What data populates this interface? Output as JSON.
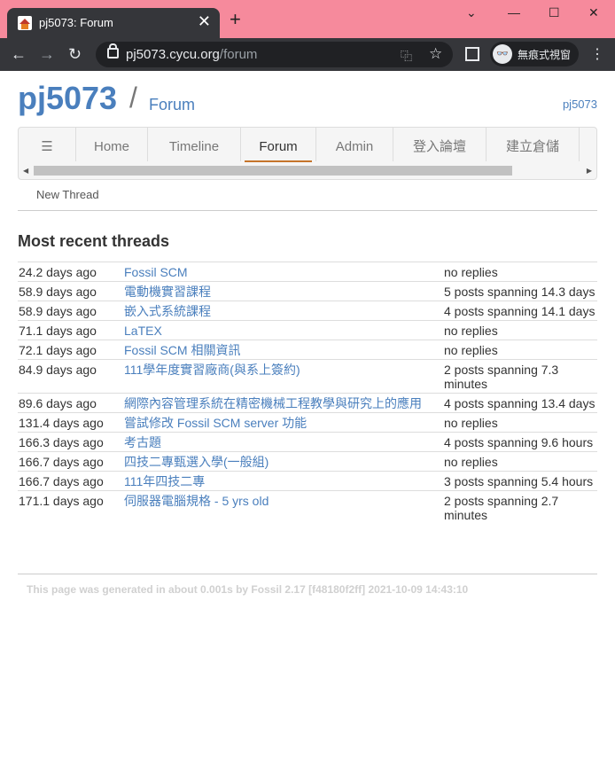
{
  "browser": {
    "tab_title": "pj5073: Forum",
    "tab_close": "✕",
    "new_tab": "+",
    "url_host": "pj5073.cycu.org",
    "url_path": "/forum",
    "incognito_label": "無痕式視窗"
  },
  "site": {
    "logo": "pj5073",
    "separator": "/",
    "section": "Forum",
    "user_link": "pj5073"
  },
  "menu": {
    "items": [
      "☰",
      "Home",
      "Timeline",
      "Forum",
      "Admin",
      "登入論壇",
      "建立倉儲"
    ],
    "active": "Forum"
  },
  "submenu": {
    "new_thread": "New Thread"
  },
  "threads": {
    "heading": "Most recent threads",
    "rows": [
      {
        "age": "24.2 days ago",
        "title": "Fossil SCM",
        "status": "no replies"
      },
      {
        "age": "58.9 days ago",
        "title": "電動機實習課程",
        "status": "5 posts spanning 14.3 days"
      },
      {
        "age": "58.9 days ago",
        "title": "嵌入式系統課程",
        "status": "4 posts spanning 14.1 days"
      },
      {
        "age": "71.1 days ago",
        "title": "LaTEX",
        "status": "no replies"
      },
      {
        "age": "72.1 days ago",
        "title": "Fossil SCM 相關資訊",
        "status": "no replies"
      },
      {
        "age": "84.9 days ago",
        "title": "111學年度實習廠商(與系上簽約)",
        "status": "2 posts spanning 7.3 minutes"
      },
      {
        "age": "89.6 days ago",
        "title": "網際內容管理系統在精密機械工程教學與研究上的應用",
        "status": "4 posts spanning 13.4 days"
      },
      {
        "age": "131.4 days ago",
        "title": "嘗試修改 Fossil SCM server 功能",
        "status": "no replies"
      },
      {
        "age": "166.3 days ago",
        "title": "考古題",
        "status": "4 posts spanning 9.6 hours"
      },
      {
        "age": "166.7 days ago",
        "title": "四技二專甄選入學(一般組)",
        "status": "no replies"
      },
      {
        "age": "166.7 days ago",
        "title": "111年四技二專",
        "status": "3 posts spanning 5.4 hours"
      },
      {
        "age": "171.1 days ago",
        "title": "伺服器電腦規格 - 5 yrs old",
        "status": "2 posts spanning 2.7 minutes"
      }
    ]
  },
  "footer": {
    "text": "This page was generated in about 0.001s by Fossil 2.17 [f48180f2ff] 2021-10-09 14:43:10"
  },
  "colors": {
    "link": "#4a7fbd",
    "tabstrip": "#f68a9c",
    "toolbar": "#35363a",
    "active_tab_underline": "#c5742b"
  }
}
